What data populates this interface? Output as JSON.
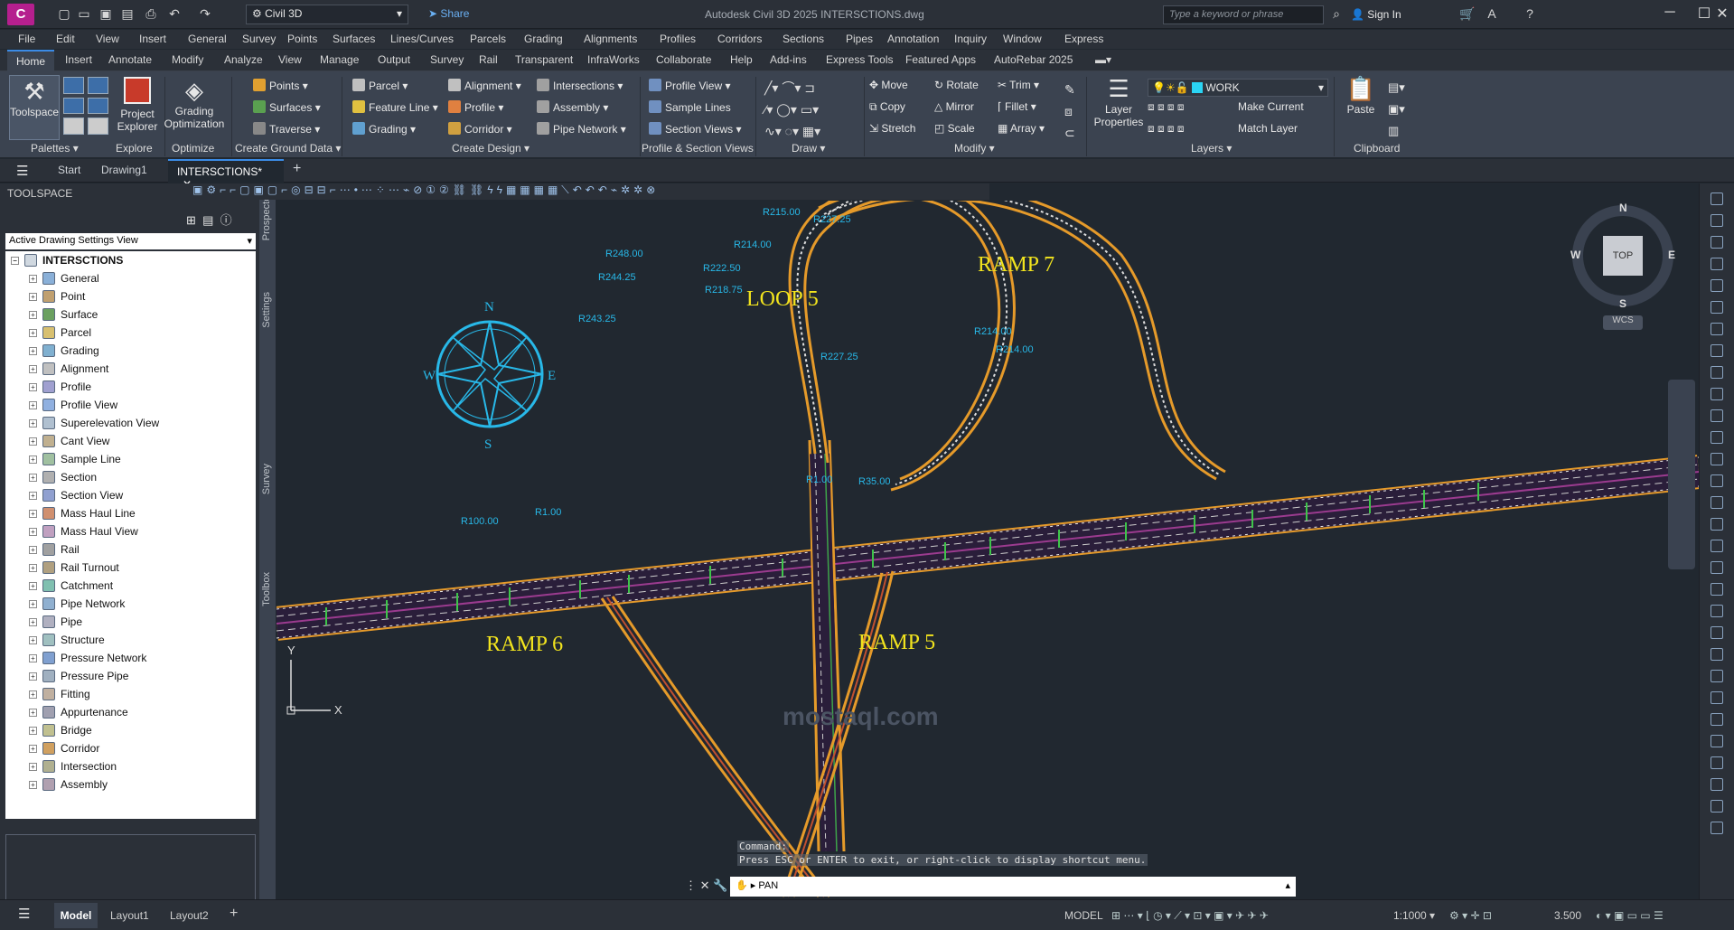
{
  "app": {
    "logo": "C",
    "workspace": "Civil 3D",
    "share": "Share",
    "title": "Autodesk Civil 3D 2025    INTERSCTIONS.dwg",
    "search_placeholder": "Type a keyword or phrase",
    "sign_in": "Sign In"
  },
  "menu": [
    "File",
    "Edit",
    "View",
    "Insert",
    "General",
    "Survey",
    "Points",
    "Surfaces",
    "Lines/Curves",
    "Parcels",
    "Grading",
    "Alignments",
    "Profiles",
    "Corridors",
    "Sections",
    "Pipes",
    "Annotation",
    "Inquiry",
    "Window",
    "Express"
  ],
  "ribbon_tabs": [
    "Home",
    "Insert",
    "Annotate",
    "Modify",
    "Analyze",
    "View",
    "Manage",
    "Output",
    "Survey",
    "Rail",
    "Transparent",
    "InfraWorks",
    "Collaborate",
    "Help",
    "Add-ins",
    "Express Tools",
    "Featured Apps",
    "AutoRebar 2025"
  ],
  "ribbon": {
    "toolspace": "Toolspace",
    "project_explorer": "Project\nExplorer",
    "grading_optimization": "Grading\nOptimization",
    "ground": [
      "Points",
      "Surfaces",
      "Traverse"
    ],
    "design_a": [
      "Parcel",
      "Feature Line",
      "Grading"
    ],
    "design_b": [
      "Alignment",
      "Profile",
      "Corridor"
    ],
    "design_c": [
      "Intersections",
      "Assembly",
      "Pipe Network"
    ],
    "profile_views": [
      "Profile View",
      "Sample Lines",
      "Section Views"
    ],
    "modify": [
      "Move",
      "Copy",
      "Stretch",
      "Rotate",
      "Mirror",
      "Scale",
      "Trim",
      "Fillet",
      "Array"
    ],
    "layer_props": "Layer\nProperties",
    "layer_name": "WORK",
    "make_current": "Make Current",
    "match_layer": "Match Layer",
    "paste": "Paste",
    "panels": [
      "Palettes",
      "Explore",
      "Optimize",
      "Create Ground Data",
      "Create Design",
      "Profile & Section Views",
      "Draw",
      "Modify",
      "Layers",
      "Clipboard"
    ]
  },
  "doc_tabs": {
    "start": "Start",
    "drawing1": "Drawing1",
    "active": "INTERSCTIONS*"
  },
  "toolspace": {
    "header": "TOOLSPACE",
    "view": "Active Drawing Settings View",
    "root": "INTERSCTIONS",
    "items": [
      "General",
      "Point",
      "Surface",
      "Parcel",
      "Grading",
      "Alignment",
      "Profile",
      "Profile View",
      "Superelevation View",
      "Cant View",
      "Sample Line",
      "Section",
      "Section View",
      "Mass Haul Line",
      "Mass Haul View",
      "Rail",
      "Rail Turnout",
      "Catchment",
      "Pipe Network",
      "Pipe",
      "Structure",
      "Pressure Network",
      "Pressure Pipe",
      "Fitting",
      "Appurtenance",
      "Bridge",
      "Corridor",
      "Intersection",
      "Assembly"
    ],
    "vtabs": [
      "Prospector",
      "Settings",
      "Survey",
      "Toolbox"
    ]
  },
  "drawing": {
    "labels": {
      "loop": "LOOP  5",
      "ramp7": "RAMP 7",
      "ramp6": "RAMP 6",
      "ramp5": "RAMP 5"
    },
    "compass": {
      "n": "N",
      "s": "S",
      "e": "E",
      "w": "W"
    },
    "radii": [
      "R215.00",
      "R227.25",
      "R214.00",
      "R248.00",
      "R222.50",
      "R244.25",
      "R218.75",
      "R243.25",
      "R227.25",
      "R214.00",
      "R214.00",
      "R1.00",
      "R35.00",
      "R100.00",
      "R1.00"
    ],
    "ucs": {
      "x": "X",
      "y": "Y"
    }
  },
  "viewcube": {
    "n": "N",
    "s": "S",
    "e": "E",
    "w": "W",
    "face": "TOP",
    "wcs": "WCS"
  },
  "command": {
    "line1": "Command:",
    "line2": "Press ESC or ENTER to exit, or right-click to display shortcut menu.",
    "input": "PAN"
  },
  "status": {
    "model_tab": "Model",
    "layout1": "Layout1",
    "layout2": "Layout2",
    "model": "MODEL",
    "scale": "1:1000",
    "annot": "3.500"
  },
  "watermark": "mostaql.com"
}
